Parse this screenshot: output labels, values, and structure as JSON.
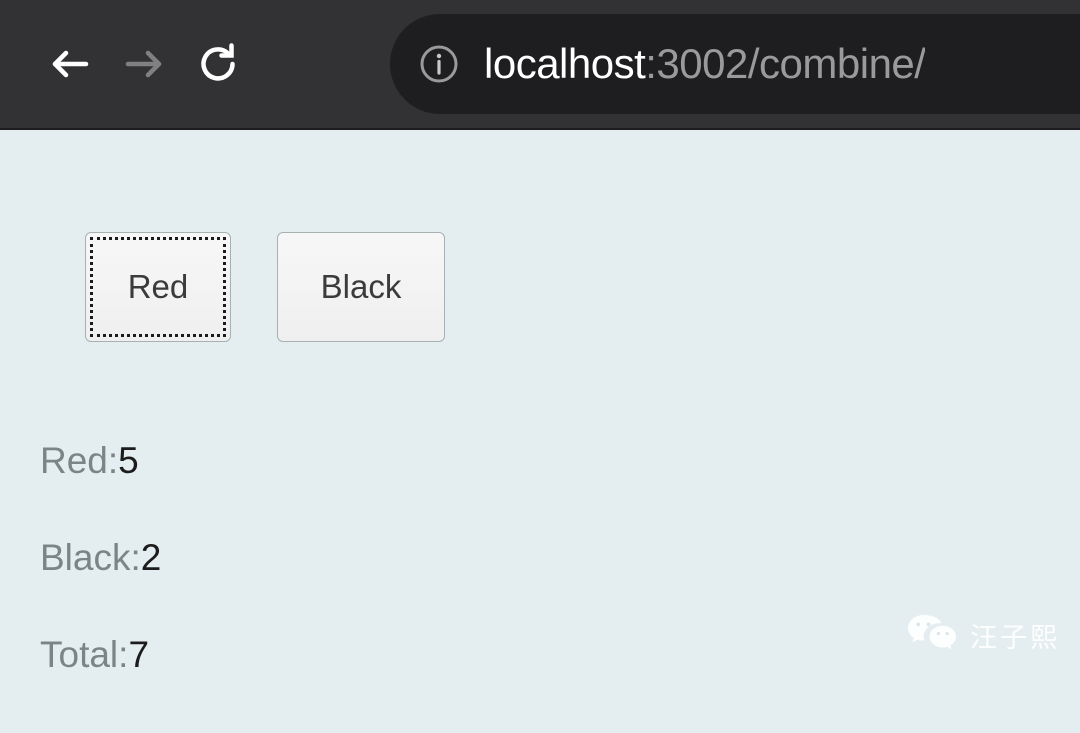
{
  "browser": {
    "back_icon": "arrow-left-icon",
    "forward_icon": "arrow-right-icon",
    "reload_icon": "reload-icon",
    "site_info_icon": "info-circle-icon",
    "url_host": "localhost",
    "url_rest": ":3002/combine/",
    "url_full": "localhost:3002/combine/",
    "colors": {
      "chrome_background": "#323234",
      "url_bar_background": "#1e1e20",
      "url_host_color": "#ffffff",
      "url_rest_color": "#9a9a9d",
      "back_arrow_color": "#ffffff",
      "forward_arrow_color": "#808083"
    }
  },
  "page": {
    "background_color": "#e4eef0",
    "buttons": [
      {
        "label": "Red",
        "focused": true
      },
      {
        "label": "Black",
        "focused": false
      }
    ],
    "counts": [
      {
        "label": "Red:",
        "value": "5"
      },
      {
        "label": "Black:",
        "value": "2"
      },
      {
        "label": "Total:",
        "value": "7"
      }
    ],
    "text_colors": {
      "label_color": "#7b8486",
      "value_color": "#1c1c1c",
      "button_text_color": "#3b3b3b"
    }
  },
  "watermark": {
    "icon": "wechat-icon",
    "text": "汪子熙",
    "color": "#ffffff"
  }
}
